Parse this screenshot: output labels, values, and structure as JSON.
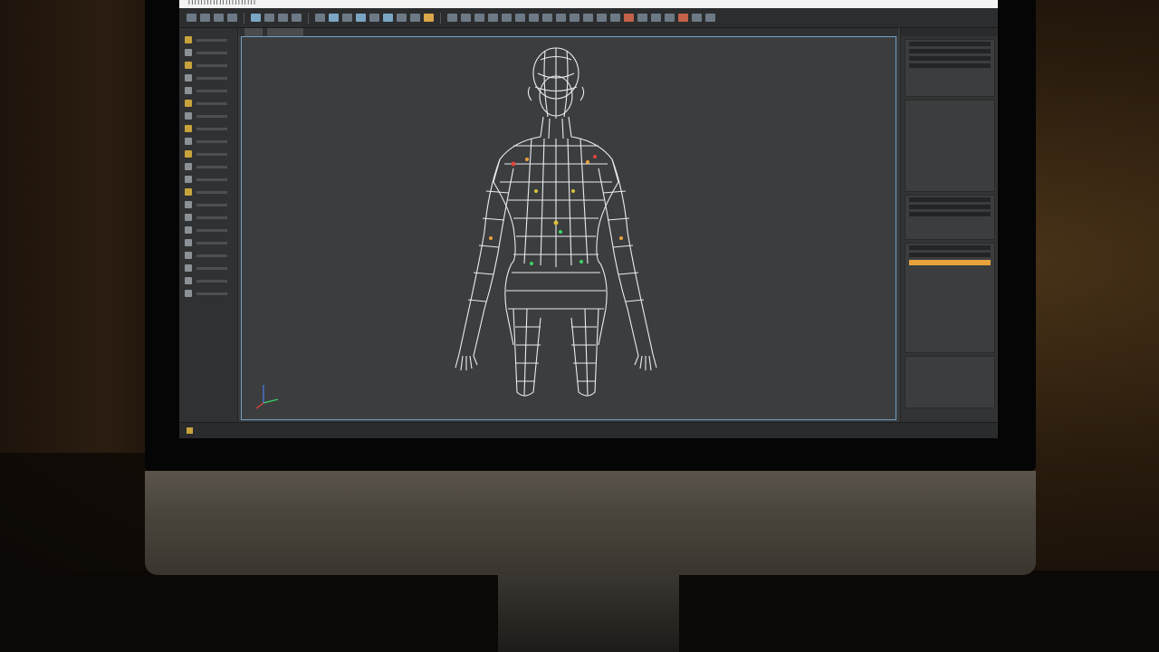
{
  "window": {
    "title": "ꟾ ꟾ ꟾ ꟾ ꟾ ꟾ ꟾ ꟾ ꟾ ꟾ ꟾ ꟾ ꟾ ꟾ ꟾ ꟾ ꟾ ꟾ ꟾ ꟾ ꟾ ꟾ"
  },
  "colors": {
    "viewport_border": "#6fa0c8",
    "wireframe": "#e8edf2",
    "accent_orange": "#e8a33c",
    "axis_x": "#e0443a",
    "axis_y": "#3bd46a",
    "axis_z": "#4a7ef0"
  },
  "toolbar": {
    "icons": [
      "file-icon",
      "save-icon",
      "undo-icon",
      "redo-icon",
      "select-icon",
      "move-icon",
      "rotate-icon",
      "scale-icon",
      "snap-icon",
      "render-icon",
      "material-icon",
      "camera-icon"
    ]
  },
  "viewport": {
    "tab_label": "",
    "view_label": ""
  },
  "left_panel": {
    "tools": [
      {
        "icon": "move-tool-icon"
      },
      {
        "icon": "rotate-tool-icon"
      },
      {
        "icon": "scale-tool-icon"
      },
      {
        "icon": "mesh-tool-icon"
      },
      {
        "icon": "brush-tool-icon"
      },
      {
        "icon": "paint-tool-icon"
      },
      {
        "icon": "sculpt-tool-icon"
      },
      {
        "icon": "smooth-tool-icon"
      },
      {
        "icon": "layer-tool-icon"
      },
      {
        "icon": "bone-tool-icon"
      },
      {
        "icon": "weight-tool-icon"
      },
      {
        "icon": "uv-tool-icon"
      },
      {
        "icon": "light-tool-icon"
      },
      {
        "icon": "camera-tool-icon"
      },
      {
        "icon": "render-tool-icon"
      }
    ]
  },
  "right_panel": {
    "header": "",
    "sections": 5
  },
  "status_bar": {
    "text": ""
  }
}
